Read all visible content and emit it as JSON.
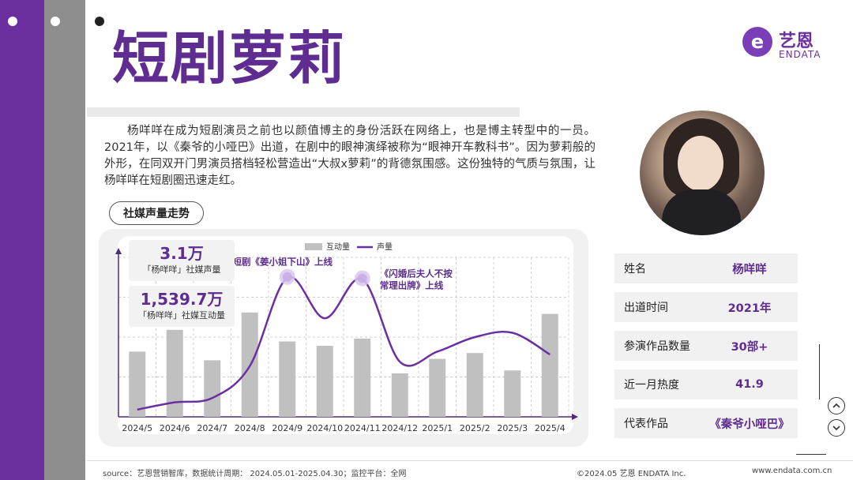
{
  "title": "短剧萝莉",
  "logo": {
    "cn": "艺恩",
    "en": "ENDATA",
    "mark": "e"
  },
  "intro": "杨咩咩在成为短剧演员之前也以颜值博主的身份活跃在网络上，也是博主转型中的一员。2021年，以《秦爷的小哑巴》出道，在剧中的眼神演绎被称为“眼神开车教科书”。因为萝莉般的外形，在同双开门男演员搭档轻松营造出“大叔x萝莉”的背德氛围感。这份独特的气质与氛围，让杨咩咩在短剧圈迅速走红。",
  "section_label": "社媒声量走势",
  "metrics": [
    {
      "value": "3.1万",
      "label": "「杨咩咩」社媒声量"
    },
    {
      "value": "1,539.7万",
      "label": "「杨咩咩」社媒互动量"
    }
  ],
  "profile": {
    "photo_icon": "portrait-photo",
    "rows": [
      {
        "label": "姓名",
        "value": "杨咩咩"
      },
      {
        "label": "出道时间",
        "value": "2021年"
      },
      {
        "label": "参演作品数量",
        "value": "30部+"
      },
      {
        "label": "近一月热度",
        "value": "41.9"
      },
      {
        "label": "代表作品",
        "value": "《秦爷小哑巴》"
      }
    ]
  },
  "controls": {
    "up_icon": "chevron-up-icon",
    "down_icon": "chevron-down-icon"
  },
  "footer": {
    "source": "source：艺恩营销智库，数据统计周期：  2024.05.01-2025.04.30；监控平台：全网",
    "copyright": "©2024.05  艺恩 ENDATA Inc.",
    "url": "www.endata.com.cn"
  },
  "colors": {
    "accent": "#5f2d91",
    "bar": "#c0c0c0",
    "line": "#6b2fa0",
    "stripe": "#6b2fa0"
  },
  "chart_data": {
    "type": "bar",
    "categories": [
      "2024/5",
      "2024/6",
      "2024/7",
      "2024/8",
      "2024/9",
      "2024/10",
      "2024/11",
      "2024/12",
      "2025/1",
      "2025/2",
      "2025/3",
      "2025/4"
    ],
    "series": [
      {
        "name": "互动量",
        "type": "bar",
        "values": [
          0.45,
          0.6,
          0.39,
          0.72,
          0.52,
          0.49,
          0.54,
          0.3,
          0.4,
          0.44,
          0.32,
          0.71
        ]
      },
      {
        "name": "声量",
        "type": "line",
        "values": [
          0.05,
          0.1,
          0.13,
          0.35,
          0.96,
          0.68,
          0.95,
          0.38,
          0.45,
          0.55,
          0.58,
          0.43
        ]
      }
    ],
    "legend": {
      "placement": "top-center"
    },
    "grid": true,
    "ylim": [
      0,
      1.1
    ],
    "annotations": [
      {
        "category": "2024/9",
        "lines": [
          "短剧《姜小姐下山》上线"
        ]
      },
      {
        "category": "2024/11",
        "lines": [
          "《闪婚后夫人不按",
          "常理出牌》上线"
        ]
      }
    ]
  }
}
